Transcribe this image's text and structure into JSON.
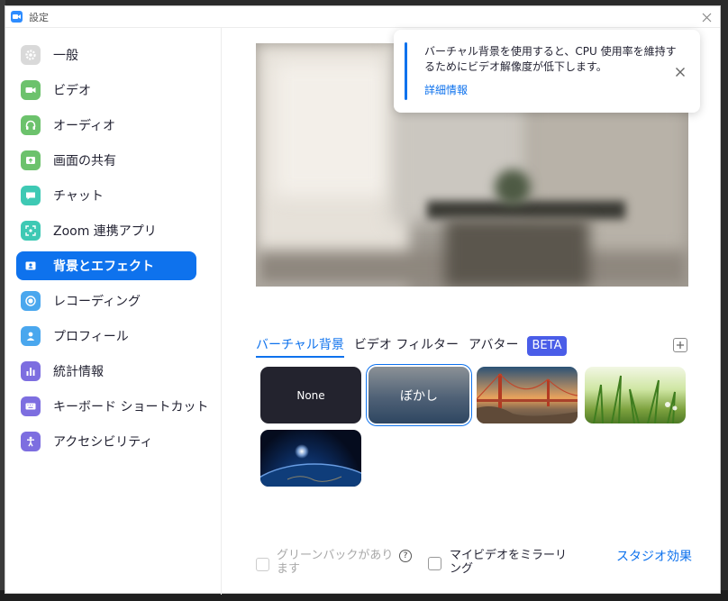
{
  "window": {
    "title": "設定"
  },
  "sidebar": {
    "items": [
      {
        "label": "一般",
        "icon": "gear-icon",
        "color": "#b8b8b8"
      },
      {
        "label": "ビデオ",
        "icon": "video-camera-icon",
        "color": "#6cc26c"
      },
      {
        "label": "オーディオ",
        "icon": "headphones-icon",
        "color": "#6cc26c"
      },
      {
        "label": "画面の共有",
        "icon": "share-screen-icon",
        "color": "#6cc26c"
      },
      {
        "label": "チャット",
        "icon": "chat-bubble-icon",
        "color": "#3ec9b4"
      },
      {
        "label": "Zoom 連携アプリ",
        "icon": "apps-icon",
        "color": "#3ec9b4"
      },
      {
        "label": "背景とエフェクト",
        "icon": "background-icon",
        "color": "#ffffff",
        "active": true
      },
      {
        "label": "レコーディング",
        "icon": "record-icon",
        "color": "#4aa7ee"
      },
      {
        "label": "プロフィール",
        "icon": "person-icon",
        "color": "#4aa7ee"
      },
      {
        "label": "統計情報",
        "icon": "bar-chart-icon",
        "color": "#7d6ee0"
      },
      {
        "label": "キーボード ショートカット",
        "icon": "keyboard-icon",
        "color": "#7d6ee0"
      },
      {
        "label": "アクセシビリティ",
        "icon": "accessibility-icon",
        "color": "#7d6ee0"
      }
    ]
  },
  "tooltip": {
    "message": "バーチャル背景を使用すると、CPU 使用率を維持するためにビデオ解像度が低下します。",
    "link": "詳細情報"
  },
  "tabs": [
    {
      "label": "バーチャル背景",
      "active": true
    },
    {
      "label": "ビデオ フィルター"
    },
    {
      "label": "アバター"
    }
  ],
  "beta_label": "BETA",
  "backgrounds": [
    {
      "name": "none",
      "label": "None"
    },
    {
      "name": "blur",
      "label": "ぼかし",
      "selected": true
    },
    {
      "name": "golden-gate-bridge",
      "label": ""
    },
    {
      "name": "grass",
      "label": ""
    },
    {
      "name": "earth-from-space",
      "label": ""
    }
  ],
  "options": {
    "green_screen": "グリーンバックがあります",
    "help_symbol": "?",
    "mirror_video": "マイビデオをミラーリング",
    "studio_effects": "スタジオ効果"
  },
  "accent_color": "#0e72ed"
}
